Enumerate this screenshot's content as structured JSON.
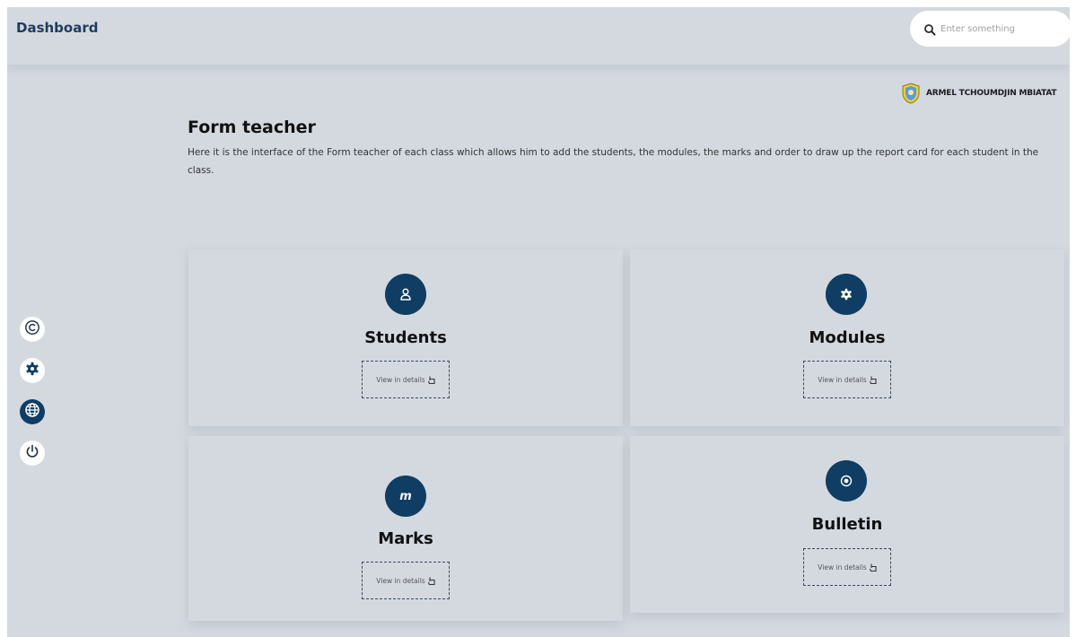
{
  "header": {
    "brand": "Dashboard",
    "search_placeholder": "Enter something"
  },
  "user": {
    "name": "ARMEL TCHOUMDJIN MBIATAT"
  },
  "sidebar": {
    "items": [
      {
        "icon": "copyright-icon"
      },
      {
        "icon": "gear-icon"
      },
      {
        "icon": "globe-icon",
        "active": true
      },
      {
        "icon": "power-icon"
      }
    ]
  },
  "page": {
    "title": "Form teacher",
    "description": "Here it is the interface of the Form teacher of each class which allows him to add the students, the modules, the marks and order to draw up the report card for each student in the class."
  },
  "cards": [
    {
      "title": "Students",
      "icon": "user-icon",
      "button": "View in details"
    },
    {
      "title": "Modules",
      "icon": "gear-icon",
      "button": "View in details"
    },
    {
      "title": "Marks",
      "icon": "m-letter-icon",
      "button": "View in details"
    },
    {
      "title": "Bulletin",
      "icon": "record-icon",
      "button": "View in details"
    }
  ],
  "colors": {
    "accent": "#0f3d63",
    "background": "#d4d9e0",
    "brand_text": "#1f3b5e"
  }
}
